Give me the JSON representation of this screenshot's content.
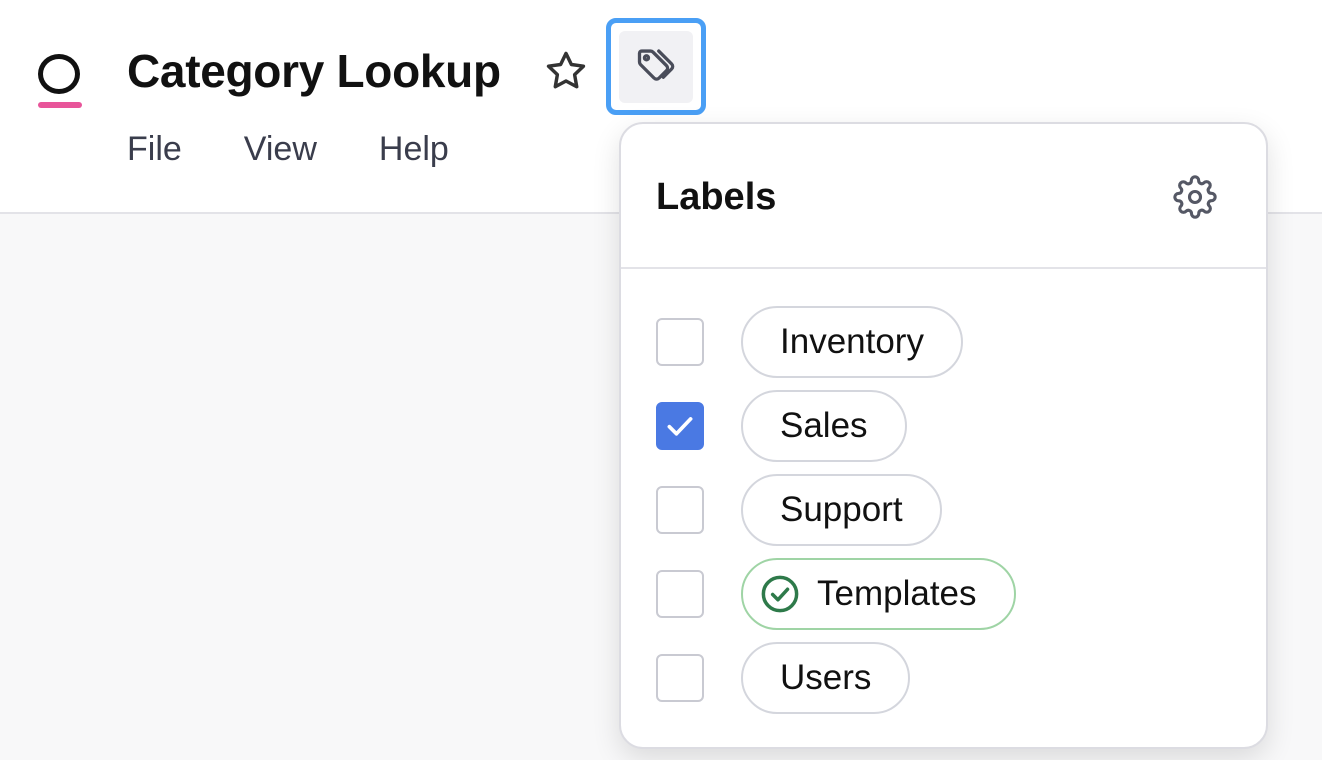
{
  "app": {
    "title": "Category Lookup",
    "brand_accent": "#e8559a"
  },
  "menu": {
    "items": [
      "File",
      "View",
      "Help"
    ]
  },
  "labels_popup": {
    "title": "Labels",
    "settings_icon": "gear-icon",
    "items": [
      {
        "label": "Inventory",
        "checked": false,
        "icon": null
      },
      {
        "label": "Sales",
        "checked": true,
        "icon": null
      },
      {
        "label": "Support",
        "checked": false,
        "icon": null
      },
      {
        "label": "Templates",
        "checked": false,
        "icon": "check-circle-icon",
        "color": "#2e7a4a"
      },
      {
        "label": "Users",
        "checked": false,
        "icon": null
      }
    ]
  },
  "colors": {
    "focus_ring": "#4a9ff5",
    "checkbox_checked": "#4a79e3",
    "template_border": "#9fd4a5"
  }
}
